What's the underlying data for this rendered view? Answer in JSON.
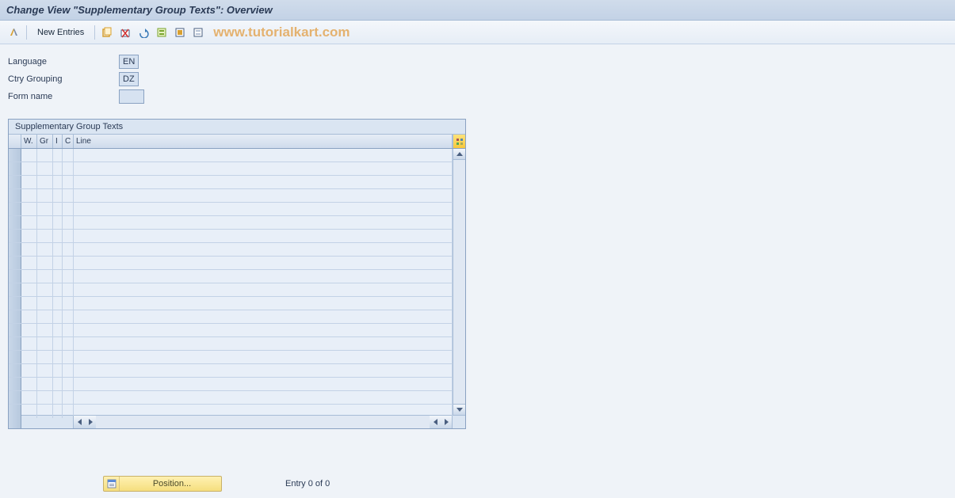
{
  "title": "Change View \"Supplementary Group Texts\": Overview",
  "toolbar": {
    "new_entries": "New Entries"
  },
  "watermark": "www.tutorialkart.com",
  "form": {
    "language_label": "Language",
    "language_value": "EN",
    "ctry_label": "Ctry Grouping",
    "ctry_value": "DZ",
    "formname_label": "Form name",
    "formname_value": ""
  },
  "grid": {
    "title": "Supplementary Group Texts",
    "columns": {
      "w": "W.",
      "gr": "Gr",
      "i": "I",
      "c": "C",
      "line": "Line"
    }
  },
  "position_button": "Position...",
  "entry_status": "Entry 0 of 0"
}
